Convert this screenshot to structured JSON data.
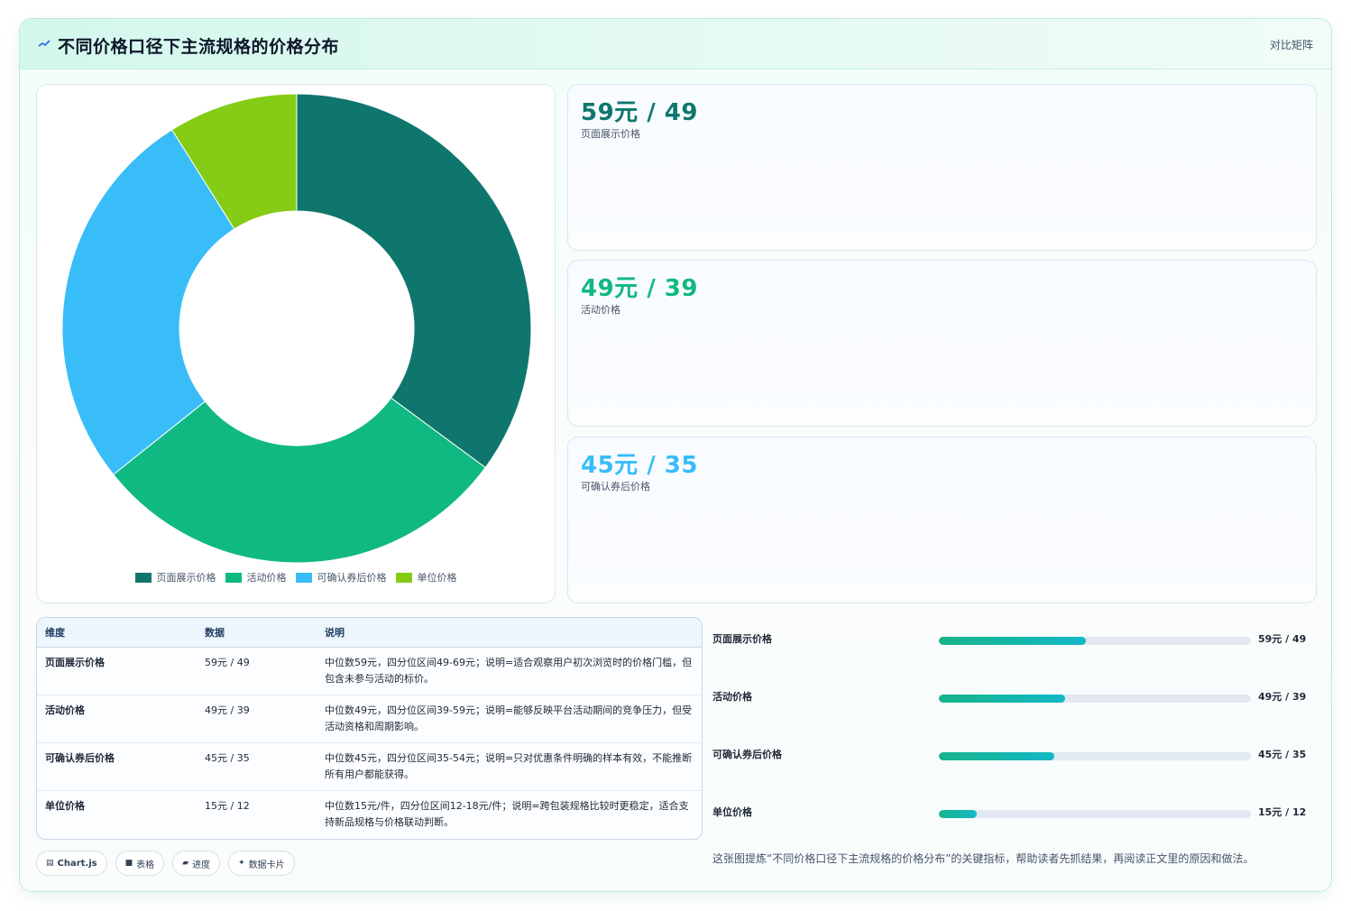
{
  "header": {
    "title": "不同价格口径下主流规格的价格分布",
    "link_label": "对比矩阵",
    "icon": "trend-line-icon"
  },
  "colors": {
    "page_display": "#0f766e",
    "activity": "#10b981",
    "coupon": "#38bdf8",
    "unit": "#84cc16"
  },
  "chart_data": {
    "type": "pie",
    "categories": [
      "页面展示价格",
      "活动价格",
      "可确认券后价格",
      "单位价格"
    ],
    "values": [
      59,
      49,
      45,
      15
    ],
    "colors": [
      "#0f766e",
      "#10b981",
      "#38bdf8",
      "#84cc16"
    ],
    "legend_position": "bottom",
    "title": ""
  },
  "stat_cards": [
    {
      "value": "59元 / 49",
      "label": "页面展示价格",
      "color": "#0f766e"
    },
    {
      "value": "49元 / 39",
      "label": "活动价格",
      "color": "#10b981"
    },
    {
      "value": "45元 / 35",
      "label": "可确认券后价格",
      "color": "#38bdf8"
    }
  ],
  "table": {
    "headers": [
      "维度",
      "数据",
      "说明"
    ],
    "rows": [
      {
        "dim": "页面展示价格",
        "data": "59元 / 49",
        "desc": "中位数59元，四分位区间49-69元；说明=适合观察用户初次浏览时的价格门槛，但包含未参与活动的标价。"
      },
      {
        "dim": "活动价格",
        "data": "49元 / 39",
        "desc": "中位数49元，四分位区间39-59元；说明=能够反映平台活动期间的竞争压力，但受活动资格和周期影响。"
      },
      {
        "dim": "可确认券后价格",
        "data": "45元 / 35",
        "desc": "中位数45元，四分位区间35-54元；说明=只对优惠条件明确的样本有效，不能推断所有用户都能获得。"
      },
      {
        "dim": "单位价格",
        "data": "15元 / 12",
        "desc": "中位数15元/件，四分位区间12-18元/件；说明=跨包装规格比较时更稳定，适合支持新品规格与价格联动判断。"
      }
    ]
  },
  "badges": [
    {
      "glyph": "▤",
      "label": "Chart.js",
      "icon": "chart-icon"
    },
    {
      "glyph": "■",
      "label": "表格",
      "icon": "table-icon"
    },
    {
      "glyph": "▰",
      "label": "进度",
      "icon": "progress-icon"
    },
    {
      "glyph": "✦",
      "label": "数据卡片",
      "icon": "card-icon"
    }
  ],
  "progress_rows": [
    {
      "label": "页面展示价格",
      "value": "59元 / 49",
      "fraction": 0.47
    },
    {
      "label": "活动价格",
      "value": "49元 / 39",
      "fraction": 0.405
    },
    {
      "label": "可确认券后价格",
      "value": "45元 / 35",
      "fraction": 0.37
    },
    {
      "label": "单位价格",
      "value": "15元 / 12",
      "fraction": 0.12
    }
  ],
  "footnote": "这张图提炼“不同价格口径下主流规格的价格分布”的关键指标，帮助读者先抓结果，再阅读正文里的原因和做法。"
}
